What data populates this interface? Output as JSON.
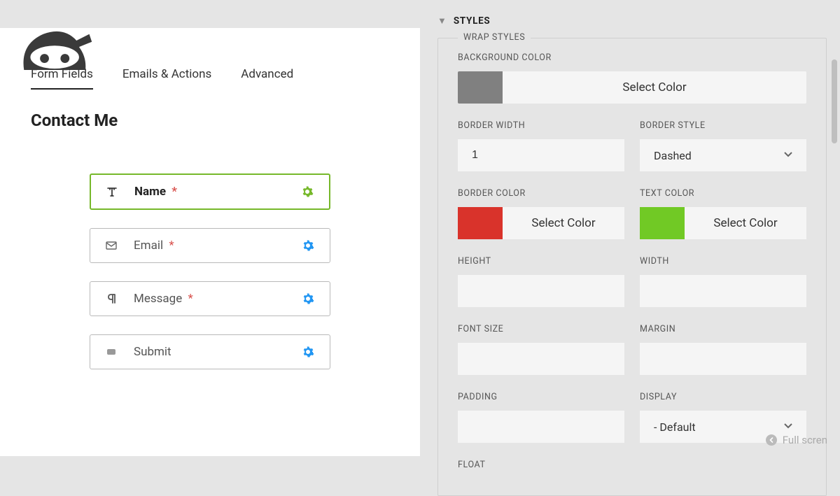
{
  "tabs": {
    "form_fields": "Form Fields",
    "emails_actions": "Emails & Actions",
    "advanced": "Advanced"
  },
  "form_title": "Contact Me",
  "fields": [
    {
      "label": "Name",
      "required": true,
      "selected": true,
      "gear_color": "#76b82a",
      "icon": "text"
    },
    {
      "label": "Email",
      "required": true,
      "selected": false,
      "gear_color": "#2196f3",
      "icon": "envelope"
    },
    {
      "label": "Message",
      "required": true,
      "selected": false,
      "gear_color": "#2196f3",
      "icon": "paragraph"
    },
    {
      "label": "Submit",
      "required": false,
      "selected": false,
      "gear_color": "#2196f3",
      "icon": "button"
    }
  ],
  "styles_panel": {
    "title": "STYLES",
    "legend": "WRAP STYLES",
    "background_color": {
      "label": "BACKGROUND COLOR",
      "swatch": "#808080",
      "btn": "Select Color"
    },
    "border_width": {
      "label": "BORDER WIDTH",
      "value": "1"
    },
    "border_style": {
      "label": "BORDER STYLE",
      "value": "Dashed"
    },
    "border_color": {
      "label": "BORDER COLOR",
      "swatch": "#d9332b",
      "btn": "Select Color"
    },
    "text_color": {
      "label": "TEXT COLOR",
      "swatch": "#71c925",
      "btn": "Select Color"
    },
    "height": {
      "label": "HEIGHT",
      "value": ""
    },
    "width": {
      "label": "WIDTH",
      "value": ""
    },
    "font_size": {
      "label": "FONT SIZE",
      "value": ""
    },
    "margin": {
      "label": "MARGIN",
      "value": ""
    },
    "padding": {
      "label": "PADDING",
      "value": ""
    },
    "display": {
      "label": "DISPLAY",
      "value": "- Default"
    },
    "float": {
      "label": "FLOAT"
    }
  },
  "full_screen": "Full scren"
}
